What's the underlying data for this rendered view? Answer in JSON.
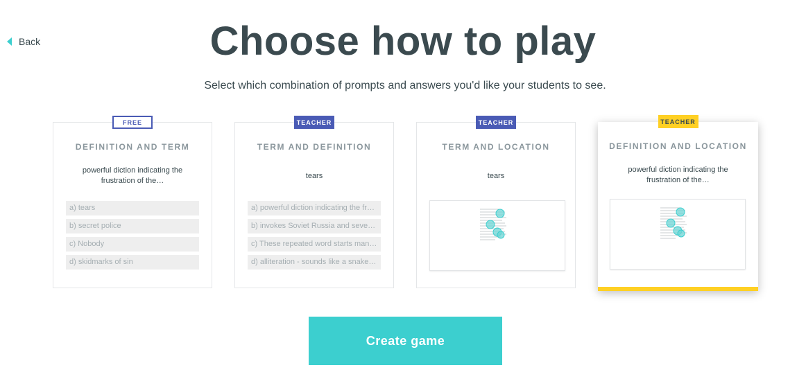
{
  "nav": {
    "back_label": "Back"
  },
  "header": {
    "title": "Choose how to play",
    "subtitle": "Select which combination of prompts and answers you'd like your students to see."
  },
  "modes": [
    {
      "badge": "FREE",
      "title": "DEFINITION AND TERM",
      "prompt": "powerful diction indicating the frustration of the…",
      "answers": [
        "a) tears",
        "b) secret police",
        "c) Nobody",
        "d) skidmarks of sin"
      ]
    },
    {
      "badge": "TEACHER",
      "title": "TERM AND DEFINITION",
      "prompt": "tears",
      "answers": [
        "a) powerful diction indicating the frustration of the…",
        "b) invokes Soviet Russia and severe punishment",
        "c) These repeated word starts many lines",
        "d) alliteration - sounds like a snake hissing"
      ]
    },
    {
      "badge": "TEACHER",
      "title": "TERM AND LOCATION",
      "prompt": "tears"
    },
    {
      "badge": "TEACHER",
      "title": "DEFINITION AND LOCATION",
      "prompt": "powerful diction indicating the frustration of the…",
      "selected": true
    }
  ],
  "actions": {
    "create_label": "Create game"
  },
  "colors": {
    "accent": "#3ccfcf",
    "badge_blue": "#4a5bb5",
    "highlight": "#ffd024"
  }
}
